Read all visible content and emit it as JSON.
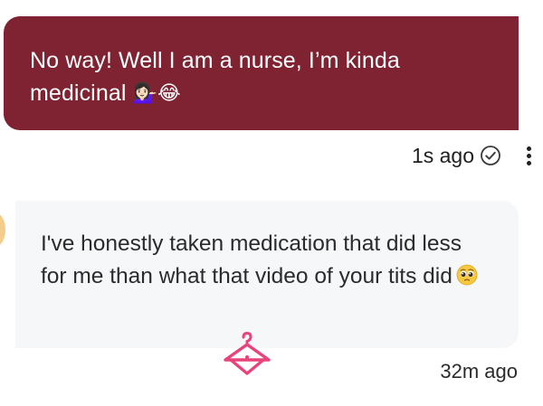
{
  "messages": {
    "sent": {
      "text_before_emoji": "No way! Well I am a nurse, I’m kinda medicinal ",
      "emoji": "💁🏻‍♀️😂",
      "timestamp": "1s ago",
      "status_icon": "check-circle-icon",
      "menu_icon": "more-vertical-icon",
      "bubble_color": "#7f2232"
    },
    "received": {
      "text_before_emoji": "I've honestly taken medication that did less for me than what that video of your tits did",
      "emoji_icon": "pleading-face-icon",
      "timestamp": "32m ago",
      "reaction_icon": "hanger-icon",
      "reaction_color": "#e8437a",
      "bubble_color": "#f6f7f9"
    }
  }
}
